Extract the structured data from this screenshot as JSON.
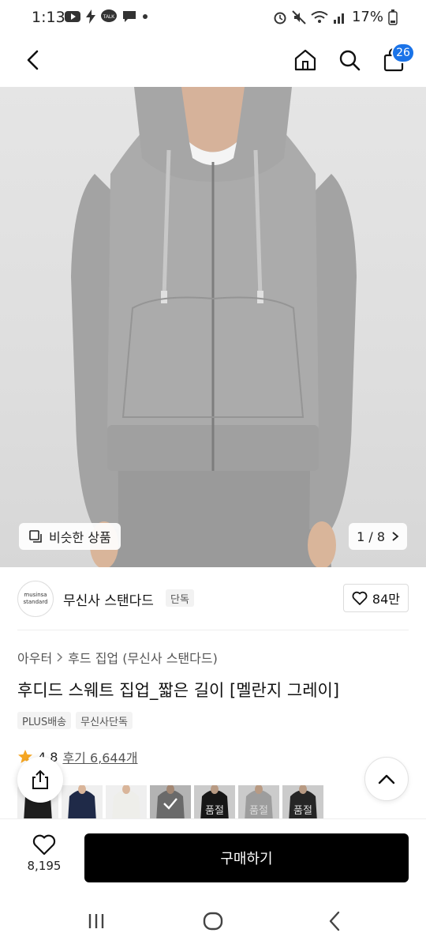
{
  "status_bar": {
    "time": "1:13",
    "battery": "17%"
  },
  "header": {
    "cart_count": "26"
  },
  "hero": {
    "similar_label": "비슷한 상품",
    "pager_text": "1 / 8"
  },
  "brand": {
    "logo_line1": "musinsa",
    "logo_line2": "standard",
    "name": "무신사 스탠다드",
    "badge": "단독",
    "likes": "84만"
  },
  "product": {
    "breadcrumb": [
      "아우터",
      "후드 집업 (무신사 스탠다드)"
    ],
    "title": "후디드 스웨트 집업_짧은 길이 [멜란지 그레이]",
    "tags": [
      "PLUS배송",
      "무신사단독"
    ],
    "rating": "4.8",
    "reviews": "후기 6,644개"
  },
  "color_thumbs": [
    {
      "color": "#1e1e1e",
      "soldout": false,
      "selected": false
    },
    {
      "color": "#1f2a48",
      "soldout": false,
      "selected": false
    },
    {
      "color": "#eeeeea",
      "soldout": false,
      "selected": false
    },
    {
      "color": "#8e8e8e",
      "soldout": false,
      "selected": true
    },
    {
      "color": "#1a1a1a",
      "soldout": true,
      "selected": false
    },
    {
      "color": "#b9b9b9",
      "soldout": true,
      "selected": false
    },
    {
      "color": "#2b2b2b",
      "soldout": true,
      "selected": false
    }
  ],
  "soldout_label": "품절",
  "bottom_bar": {
    "wish_count": "8,195",
    "buy_label": "구매하기"
  },
  "colors": {
    "accent": "#1a73e8",
    "buy_button": "#000000",
    "rating_star": "#f5a623"
  }
}
